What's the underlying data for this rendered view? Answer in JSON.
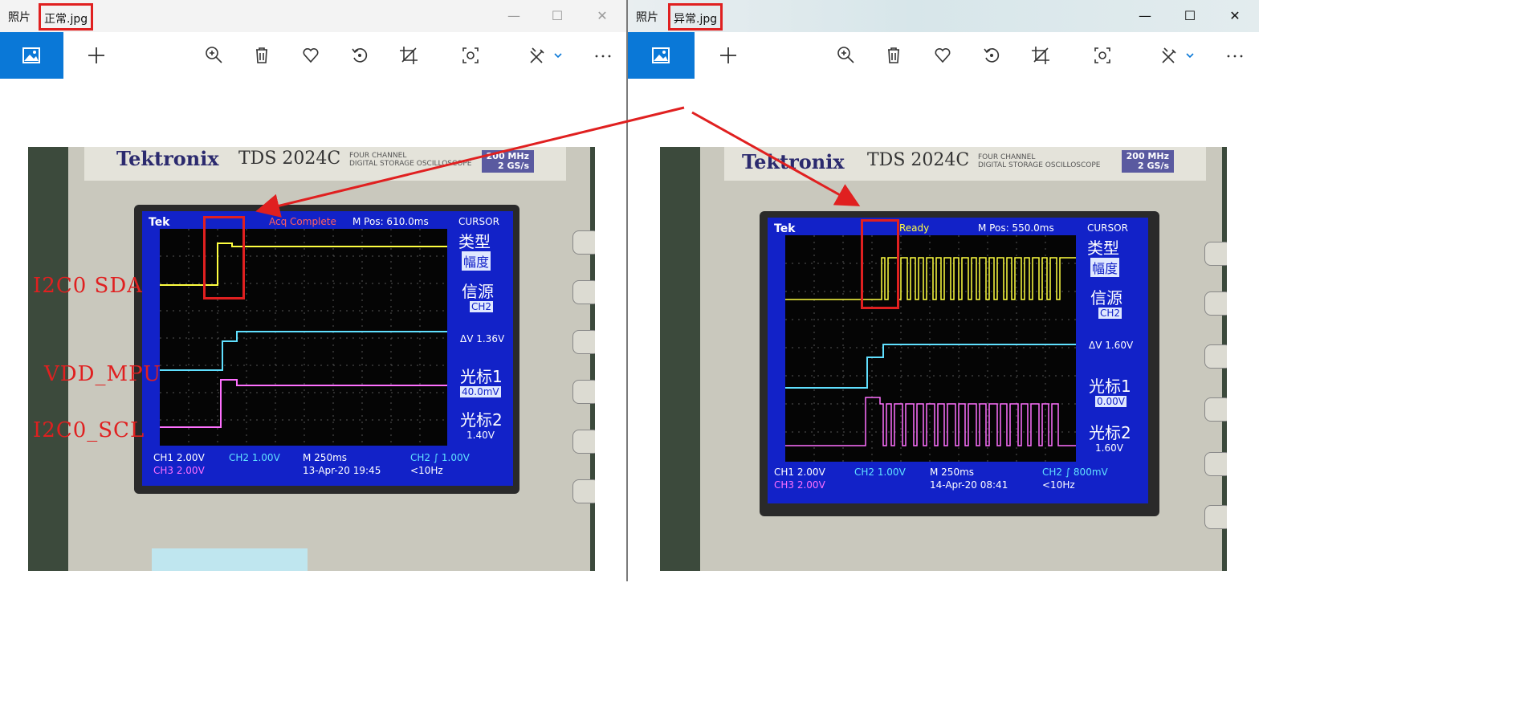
{
  "windows": [
    {
      "app_title": "照片",
      "file_name": "正常.jpg",
      "controls": {
        "minimize": "—",
        "maximize": "☐",
        "close": "✕"
      },
      "toolbar": [
        "view-image-icon",
        "add-icon",
        "zoom-in-icon",
        "delete-icon",
        "favorite-icon",
        "rotate-icon",
        "crop-icon",
        "enhance-icon",
        "edit-icon",
        "more-icon"
      ],
      "photo": {
        "brand": "Tektronix",
        "model": "TDS 2024C",
        "model_sub": "FOUR CHANNEL\nDIGITAL STORAGE OSCILLOSCOPE",
        "rate": "200 MHz\n2 GS/s",
        "screen": {
          "tek": "Tek",
          "status": "Acq Complete",
          "mpos": "M Pos: 610.0ms",
          "menu_title": "CURSOR",
          "menu_type": "类型",
          "menu_type_val": "幅度",
          "menu_source": "信源",
          "menu_source_val": "CH2",
          "delta_v": "ΔV 1.36V",
          "cursor1": "光标1",
          "cursor1_val": "40.0mV",
          "cursor2": "光标2",
          "cursor2_val": "1.40V",
          "ch1": "CH1  2.00V",
          "ch2": "CH2  1.00V",
          "ch3": "CH3  2.00V",
          "timebase": "M 250ms",
          "timestamp": "13-Apr-20 19:45",
          "trigger": "CH2 ∫ 1.00V",
          "freq": "<10Hz"
        },
        "annotations": [
          "I2C0 SDA",
          "VDD_MPU",
          "I2C0_SCL"
        ]
      }
    },
    {
      "app_title": "照片",
      "file_name": "异常.jpg",
      "controls": {
        "minimize": "—",
        "maximize": "☐",
        "close": "✕"
      },
      "toolbar": [
        "view-image-icon",
        "add-icon",
        "zoom-in-icon",
        "delete-icon",
        "favorite-icon",
        "rotate-icon",
        "crop-icon",
        "enhance-icon",
        "edit-icon",
        "more-icon"
      ],
      "photo": {
        "brand": "Tektronix",
        "model": "TDS 2024C",
        "model_sub": "FOUR CHANNEL\nDIGITAL STORAGE OSCILLOSCOPE",
        "rate": "200 MHz\n2 GS/s",
        "screen": {
          "tek": "Tek",
          "status": "Ready",
          "mpos": "M Pos: 550.0ms",
          "menu_title": "CURSOR",
          "menu_type": "类型",
          "menu_type_val": "幅度",
          "menu_source": "信源",
          "menu_source_val": "CH2",
          "delta_v": "ΔV 1.60V",
          "cursor1": "光标1",
          "cursor1_val": "0.00V",
          "cursor2": "光标2",
          "cursor2_val": "1.60V",
          "ch1": "CH1  2.00V",
          "ch2": "CH2  1.00V",
          "ch3": "CH3  2.00V",
          "timebase": "M 250ms",
          "timestamp": "14-Apr-20 08:41",
          "trigger": "CH2 ∫ 800mV",
          "freq": "<10Hz"
        },
        "annotations": []
      }
    }
  ],
  "colors": {
    "accent": "#0a78d7",
    "highlight": "#e02020",
    "ch1": "#ffff40",
    "ch2": "#60e0ff",
    "ch3": "#ff70ff"
  }
}
